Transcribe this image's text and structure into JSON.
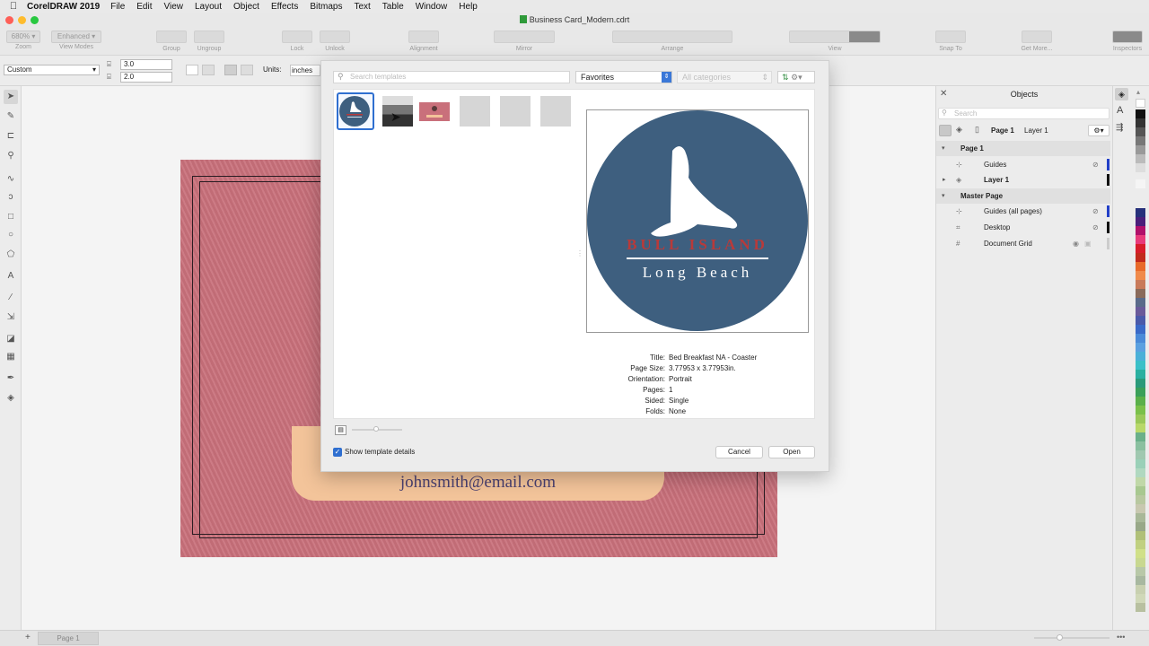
{
  "menubar": {
    "app_name": "CorelDRAW 2019",
    "items": [
      "File",
      "Edit",
      "View",
      "Layout",
      "Object",
      "Effects",
      "Bitmaps",
      "Text",
      "Table",
      "Window",
      "Help"
    ]
  },
  "window": {
    "title": "Business Card_Modern.cdrt"
  },
  "toolbar": {
    "zoom_value": "680%",
    "view_mode_value": "Enhanced",
    "labels": {
      "zoom": "Zoom",
      "view_modes": "View Modes",
      "group": "Group",
      "ungroup": "Ungroup",
      "lock": "Lock",
      "unlock": "Unlock",
      "alignment": "Alignment",
      "mirror": "Mirror",
      "arrange": "Arrange",
      "view": "View",
      "snap_to": "Snap To",
      "get_more": "Get More...",
      "inspectors": "Inspectors"
    }
  },
  "propbar": {
    "preset": "Custom",
    "width": "3.0",
    "height": "2.0",
    "units_label": "Units:",
    "units_value": "inches"
  },
  "canvas": {
    "email": "johnsmith@email.com"
  },
  "dialog": {
    "search_placeholder": "Search templates",
    "collection": "Favorites",
    "category": "All categories",
    "preview": {
      "line1": "BULL ISLAND",
      "line2": "Long Beach"
    },
    "details": [
      {
        "key": "Title:",
        "value": "Bed  Breakfast NA - Coaster"
      },
      {
        "key": "Page Size:",
        "value": "3.77953 x 3.77953in."
      },
      {
        "key": "Orientation:",
        "value": "Portrait"
      },
      {
        "key": "Pages:",
        "value": "1"
      },
      {
        "key": "Sided:",
        "value": "Single"
      },
      {
        "key": "Folds:",
        "value": "None"
      }
    ],
    "show_details_label": "Show template details",
    "show_details_checked": true,
    "cancel_label": "Cancel",
    "open_label": "Open"
  },
  "objects_panel": {
    "title": "Objects",
    "search_placeholder": "Search",
    "current_page": "Page 1",
    "current_layer": "Layer 1",
    "tree": [
      {
        "label": "Page 1"
      },
      {
        "label": "Guides"
      },
      {
        "label": "Layer 1"
      },
      {
        "label": "Master Page"
      },
      {
        "label": "Guides (all pages)"
      },
      {
        "label": "Desktop"
      },
      {
        "label": "Document Grid"
      }
    ]
  },
  "statusbar": {
    "page_tab": "Page 1"
  },
  "colors": {
    "card": "#c9707b",
    "pill": "#f3c49a",
    "seal_circle": "#3e5f7f",
    "accent_red": "#b83a3a",
    "selection_blue": "#2f6fd0"
  }
}
